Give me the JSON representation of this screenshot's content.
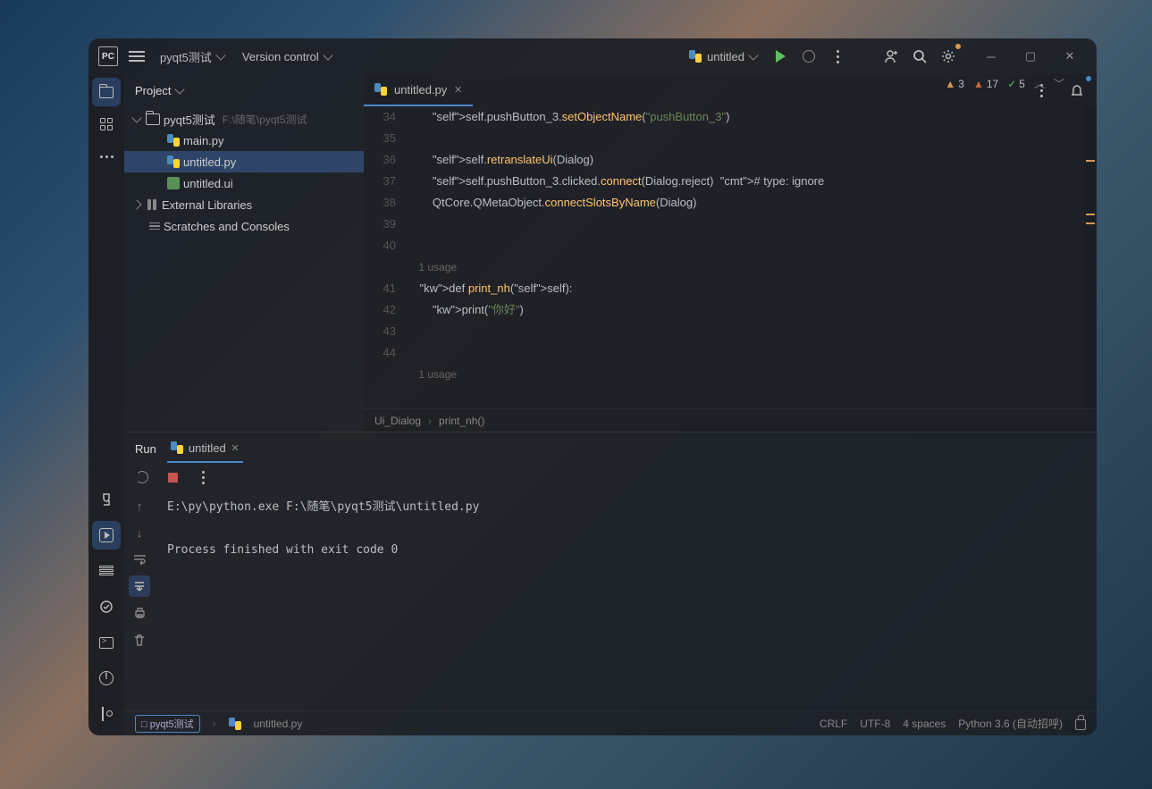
{
  "titlebar": {
    "app_logo": "PC",
    "project": "pyqt5测试",
    "vcs": "Version control",
    "run_config": "untitled"
  },
  "project_panel": {
    "title": "Project",
    "root": "pyqt5测试",
    "root_path": "F:\\随笔\\pyqt5测试",
    "files": [
      "main.py",
      "untitled.py",
      "untitled.ui"
    ],
    "ext_lib": "External Libraries",
    "scratches": "Scratches and Consoles"
  },
  "editor": {
    "tab": "untitled.py",
    "inspections": {
      "err": "3",
      "warn": "17",
      "typo": "5"
    },
    "lines": [
      {
        "n": "34",
        "t": "        self.pushButton_3.setObjectName(\"pushButton_3\")"
      },
      {
        "n": "35",
        "t": ""
      },
      {
        "n": "36",
        "t": "        self.retranslateUi(Dialog)"
      },
      {
        "n": "37",
        "t": "        self.pushButton_3.clicked.connect(Dialog.reject)  # type: ignore"
      },
      {
        "n": "38",
        "t": "        QtCore.QMetaObject.connectSlotsByName(Dialog)"
      },
      {
        "n": "39",
        "t": ""
      },
      {
        "n": "40",
        "t": ""
      },
      {
        "n": "",
        "t": "    1 usage",
        "hint": true
      },
      {
        "n": "41",
        "t": "    def print_nh(self):"
      },
      {
        "n": "42",
        "t": "        print(\"你好\")"
      },
      {
        "n": "43",
        "t": ""
      },
      {
        "n": "44",
        "t": ""
      },
      {
        "n": "",
        "t": "    1 usage",
        "hint": true
      }
    ],
    "breadcrumb": [
      "Ui_Dialog",
      "print_nh()"
    ]
  },
  "run": {
    "title": "Run",
    "tab": "untitled",
    "output": "E:\\py\\python.exe F:\\随笔\\pyqt5测试\\untitled.py\n\nProcess finished with exit code 0"
  },
  "status": {
    "branch_chip": "pyqt5测试",
    "file": "untitled.py",
    "eol": "CRLF",
    "enc": "UTF-8",
    "indent": "4 spaces",
    "interpreter": "Python 3.6 (自动招呼)"
  }
}
